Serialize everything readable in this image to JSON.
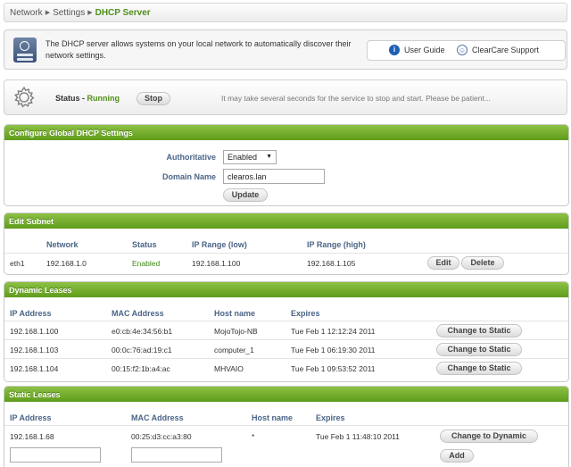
{
  "breadcrumb": {
    "items": [
      "Network",
      "Settings"
    ],
    "current": "DHCP Server"
  },
  "info": {
    "text": "The DHCP server allows systems on your local network to automatically discover their network settings.",
    "user_guide": "User Guide",
    "support": "ClearCare Support"
  },
  "status": {
    "label": "Status",
    "dash": " - ",
    "state": "Running",
    "stop_label": "Stop",
    "note": "It may take several seconds for the service to stop and start.  Please be patient..."
  },
  "global": {
    "title": "Configure Global DHCP Settings",
    "authoritative_label": "Authoritative",
    "authoritative_value": "Enabled",
    "domain_label": "Domain Name",
    "domain_value": "clearos.lan",
    "update_label": "Update"
  },
  "subnet": {
    "title": "Edit Subnet",
    "headers": [
      "Network",
      "Status",
      "IP Range (low)",
      "IP Range (high)"
    ],
    "row": {
      "iface": "eth1",
      "network": "192.168.1.0",
      "status": "Enabled",
      "low": "192.168.1.100",
      "high": "192.168.1.105"
    },
    "edit_label": "Edit",
    "delete_label": "Delete"
  },
  "dynamic": {
    "title": "Dynamic Leases",
    "headers": [
      "IP Address",
      "MAC Address",
      "Host name",
      "Expires"
    ],
    "rows": [
      {
        "ip": "192.168.1.100",
        "mac": "e0:cb:4e:34:56:b1",
        "host": "MojoTojo-NB",
        "expires": "Tue Feb 1 12:12:24 2011"
      },
      {
        "ip": "192.168.1.103",
        "mac": "00:0c:76:ad:19:c1",
        "host": "computer_1",
        "expires": "Tue Feb 1 06:19:30 2011"
      },
      {
        "ip": "192.168.1.104",
        "mac": "00:15:f2:1b:a4:ac",
        "host": "MHVAIO",
        "expires": "Tue Feb 1 09:53:52 2011"
      }
    ],
    "action_label": "Change to Static"
  },
  "static": {
    "title": "Static Leases",
    "headers": [
      "IP Address",
      "MAC Address",
      "Host name",
      "Expires"
    ],
    "row": {
      "ip": "192.168.1.68",
      "mac": "00:25:d3:cc:a3:80",
      "host": "*",
      "expires": "Tue Feb 1 11:48:10 2011"
    },
    "action_label": "Change to Dynamic",
    "ip_input_value": "",
    "mac_input_value": "",
    "add_label": "Add"
  }
}
